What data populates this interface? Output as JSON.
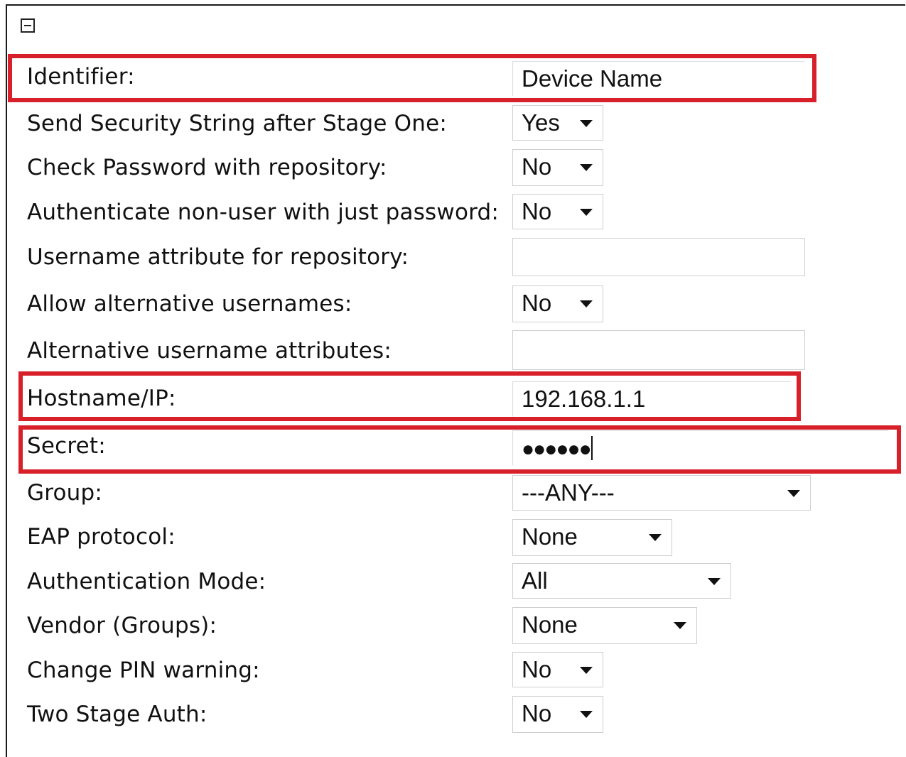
{
  "colors": {
    "highlight": "#d7202a",
    "border": "#cfcfcf",
    "text": "#111111"
  },
  "icons": {
    "collapse": "collapse-minus-icon",
    "dropdown": "chevron-down-icon"
  },
  "form": {
    "identifier": {
      "label": "Identifier:",
      "value": "Device Name"
    },
    "send_security_string": {
      "label": "Send Security String after Stage One:",
      "value": "Yes"
    },
    "check_password": {
      "label": "Check Password with repository:",
      "value": "No"
    },
    "authenticate_non_user": {
      "label": "Authenticate non-user with just password:",
      "value": "No"
    },
    "username_attribute": {
      "label": "Username attribute for repository:",
      "value": ""
    },
    "allow_alt_usernames": {
      "label": "Allow alternative usernames:",
      "value": "No"
    },
    "alt_username_attributes": {
      "label": "Alternative username attributes:",
      "value": ""
    },
    "hostname_ip": {
      "label": "Hostname/IP:",
      "value": "192.168.1.1"
    },
    "secret": {
      "label": "Secret:",
      "value": "●●●●●●"
    },
    "group": {
      "label": "Group:",
      "value": "---ANY---"
    },
    "eap_protocol": {
      "label": "EAP protocol:",
      "value": "None"
    },
    "authentication_mode": {
      "label": "Authentication Mode:",
      "value": "All"
    },
    "vendor_groups": {
      "label": "Vendor (Groups):",
      "value": "None"
    },
    "change_pin_warning": {
      "label": "Change PIN warning:",
      "value": "No"
    },
    "two_stage_auth": {
      "label": "Two Stage Auth:",
      "value": "No"
    }
  }
}
